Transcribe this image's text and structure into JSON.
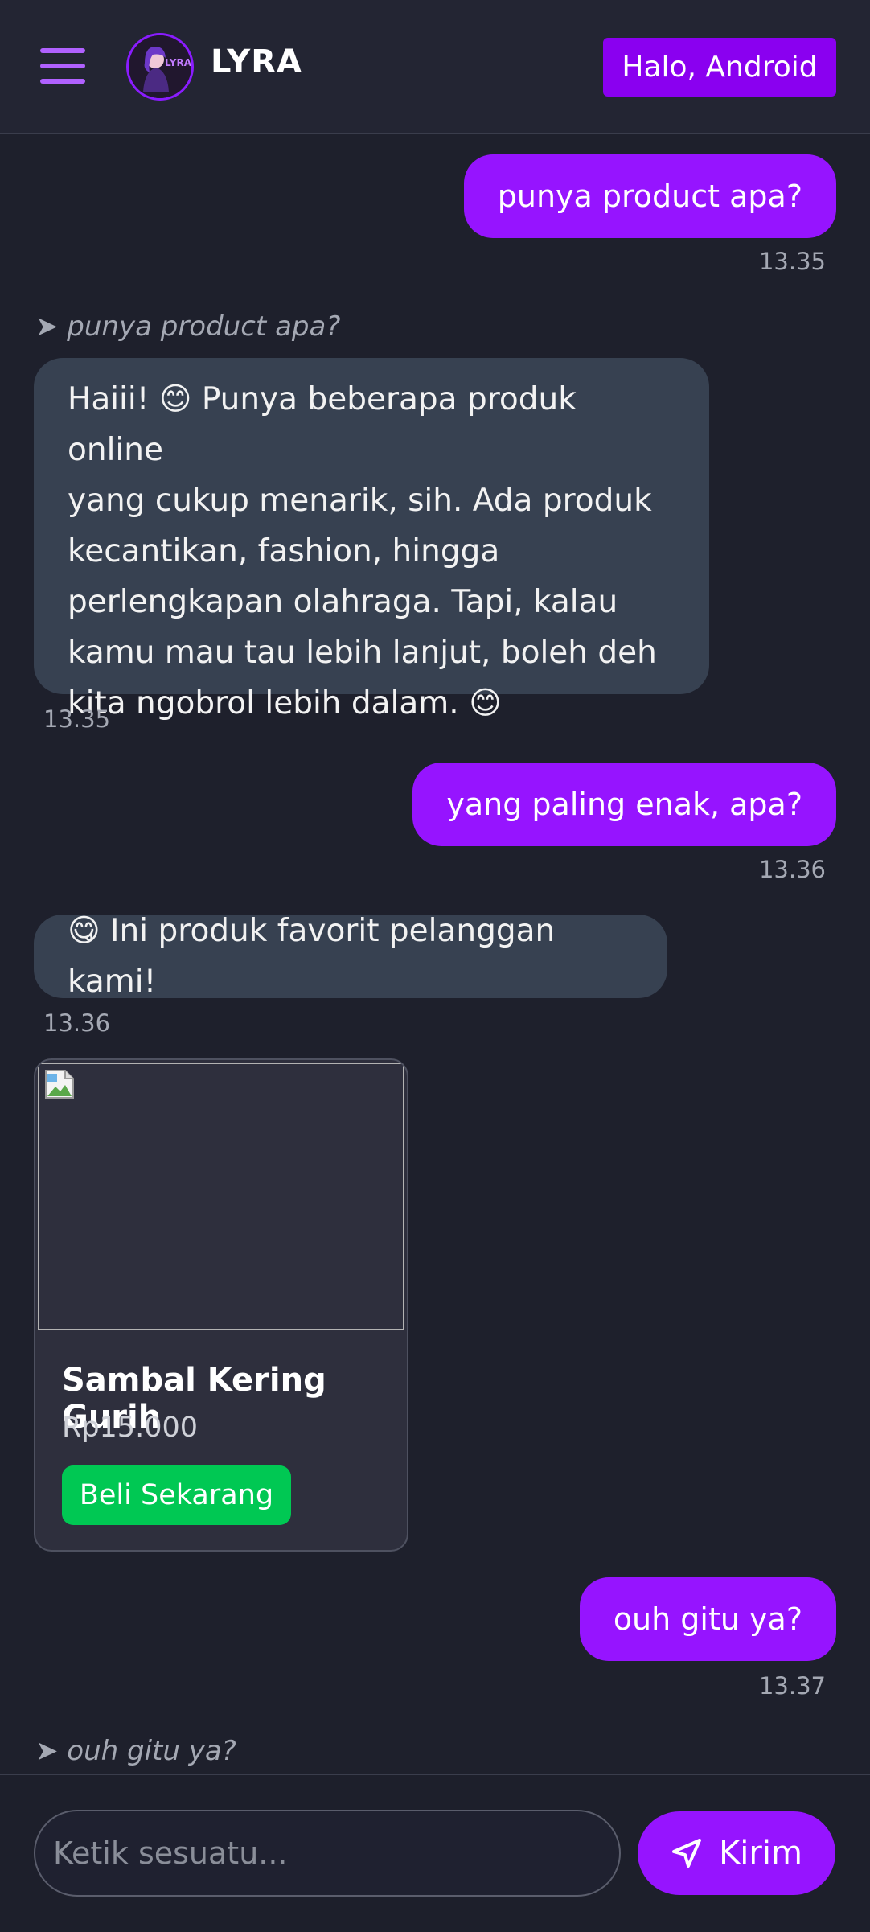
{
  "header": {
    "brand": "LYRA",
    "avatar_text": "LYRA",
    "greeting_button": "Halo, Android"
  },
  "messages": [
    {
      "sender": "user",
      "text": "punya product apa?",
      "time": "13.35"
    },
    {
      "type": "quote",
      "text": "➤ punya product apa?"
    },
    {
      "sender": "bot",
      "lines": [
        "Haiii! 😊 Punya beberapa produk online",
        "yang cukup menarik, sih. Ada produk",
        "kecantikan, fashion, hingga",
        "perlengkapan olahraga. Tapi, kalau",
        "kamu mau tau lebih lanjut, boleh deh",
        "kita ngobrol lebih dalam. 😊"
      ],
      "time": "13.35"
    },
    {
      "sender": "user",
      "text": "yang paling enak, apa?",
      "time": "13.36"
    },
    {
      "sender": "bot",
      "text": "😋 Ini produk favorit pelanggan kami!",
      "time": "13.36"
    },
    {
      "sender": "user",
      "text": "ouh gitu ya?",
      "time": "13.37"
    },
    {
      "type": "quote",
      "text": "➤ ouh gitu ya?"
    }
  ],
  "product_card": {
    "name": "Sambal Kering Gurih",
    "price": "Rp15.000",
    "buy_label": "Beli Sekarang"
  },
  "composer": {
    "placeholder": "Ketik sesuatu...",
    "send_label": "Kirim"
  },
  "colors": {
    "background": "#1e202c",
    "accent": "#9614ff",
    "bot_bubble": "#374151",
    "buy_button": "#00c853"
  }
}
